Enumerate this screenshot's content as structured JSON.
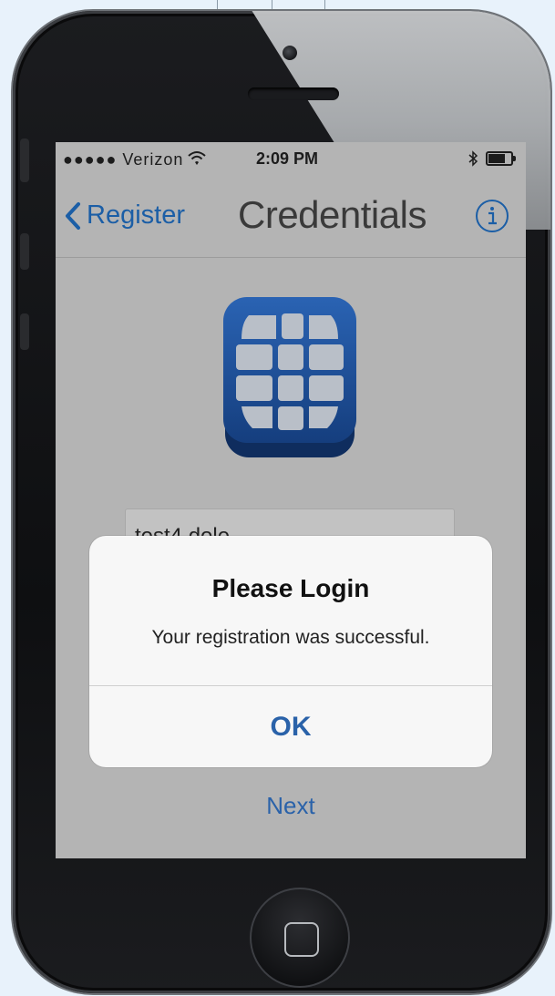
{
  "statusbar": {
    "carrier": "●●●●● Verizon",
    "time": "2:09 PM",
    "wifi_icon": "wifi-icon",
    "bluetooth_icon": "bluetooth-icon"
  },
  "navbar": {
    "back_label": "Register",
    "title": "Credentials",
    "info_icon": "info-icon"
  },
  "form": {
    "username_value": "test4.dole"
  },
  "alert": {
    "title": "Please Login",
    "message": "Your registration was successful.",
    "ok_label": "OK"
  },
  "footer": {
    "next_label": "Next"
  },
  "colors": {
    "accent": "#2a62a9",
    "screen_bg": "#b4b4b4",
    "alert_bg": "#f7f7f7",
    "logo_blue": "#1f4f9a"
  }
}
